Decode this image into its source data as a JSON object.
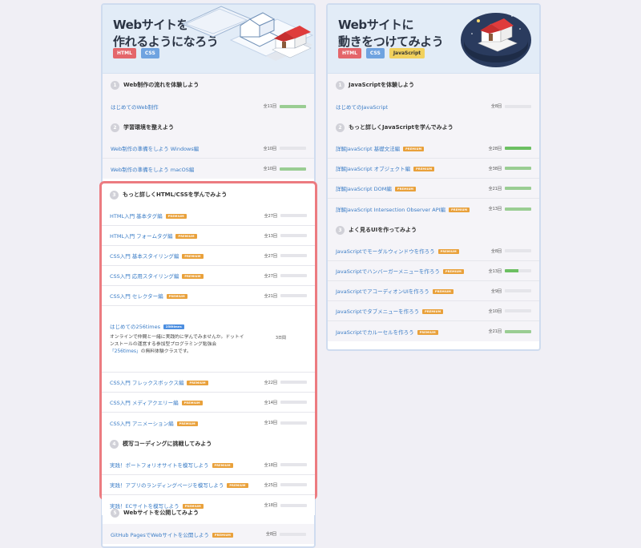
{
  "left": {
    "title": "Webサイトを\n作れるようになろう",
    "tags": [
      "HTML",
      "CSS"
    ],
    "sections": [
      {
        "num": "1",
        "title": "Web制作の流れを体験しよう",
        "items": [
          {
            "title": "はじめてのWeb制作",
            "badge": "",
            "count": "全11回",
            "progress": 1.0
          }
        ]
      },
      {
        "num": "2",
        "title": "学習環境を整えよう",
        "items": [
          {
            "title": "Web制作の準備をしよう Windows編",
            "badge": "",
            "count": "全10回",
            "progress": 0
          },
          {
            "title": "Web制作の準備をしよう macOS編",
            "badge": "",
            "count": "全10回",
            "progress": 1.0
          }
        ]
      }
    ],
    "highlight_sections": [
      {
        "num": "3",
        "title": "もっと詳しくHTML/CSSを学んでみよう",
        "items": [
          {
            "title": "HTML入門 基本タグ編",
            "badge": "PREMIUM",
            "count": "全27回",
            "progress": 0
          },
          {
            "title": "HTML入門 フォームタグ編",
            "badge": "PREMIUM",
            "count": "全13回",
            "progress": 0
          },
          {
            "title": "CSS入門 基本スタイリング編",
            "badge": "PREMIUM",
            "count": "全27回",
            "progress": 0
          },
          {
            "title": "CSS入門 応用スタイリング編",
            "badge": "PREMIUM",
            "count": "全27回",
            "progress": 0
          },
          {
            "title": "CSS入門 セレクター編",
            "badge": "PREMIUM",
            "count": "全21回",
            "progress": 0
          }
        ]
      },
      {
        "extra": {
          "title": "はじめての256times",
          "badge": "256times",
          "desc1": "オンラインで仲間と一緒に実践的に学んでみませんか。ドットインストールの運営する参加型プログラミング勉強会",
          "link": "「256times」",
          "desc2": "の無料体験クラスです。",
          "count": "3日間"
        }
      },
      {
        "items": [
          {
            "title": "CSS入門 フレックスボックス編",
            "badge": "PREMIUM",
            "count": "全22回",
            "progress": 0
          },
          {
            "title": "CSS入門 メディアクエリー編",
            "badge": "PREMIUM",
            "count": "全14回",
            "progress": 0
          },
          {
            "title": "CSS入門 アニメーション編",
            "badge": "PREMIUM",
            "count": "全19回",
            "progress": 0
          }
        ]
      },
      {
        "num": "4",
        "title": "模写コーディングに挑戦してみよう",
        "items": [
          {
            "title": "実践！ポートフォリオサイトを模写しよう",
            "badge": "PREMIUM",
            "count": "全18回",
            "progress": 0
          },
          {
            "title": "実践！アプリのランディングページを模写しよう",
            "badge": "PREMIUM",
            "count": "全25回",
            "progress": 0
          },
          {
            "title": "実践！ECサイトを模写しよう",
            "badge": "PREMIUM",
            "count": "全18回",
            "progress": 0
          }
        ]
      }
    ],
    "lower_sections": [
      {
        "num": "5",
        "title": "Webサイトを公開してみよう",
        "items": [
          {
            "title": "GitHub PagesでWebサイトを公開しよう",
            "badge": "PREMIUM",
            "count": "全8回",
            "progress": 0
          }
        ]
      }
    ]
  },
  "right": {
    "title": "Webサイトに\n動きをつけてみよう",
    "tags": [
      "HTML",
      "CSS",
      "JavaScript"
    ],
    "sections": [
      {
        "num": "1",
        "title": "JavaScriptを体験しよう",
        "items": [
          {
            "title": "はじめてのJavaScript",
            "badge": "",
            "count": "全8回",
            "progress": 0
          }
        ]
      },
      {
        "num": "2",
        "title": "もっと詳しくJavaScriptを学んでみよう",
        "items": [
          {
            "title": "詳解JavaScript 基礎文法編",
            "badge": "PREMIUM",
            "count": "全28回",
            "progress": 1.0
          },
          {
            "title": "詳解JavaScript オブジェクト編",
            "badge": "PREMIUM",
            "count": "全38回",
            "progress": 1.0
          },
          {
            "title": "詳解JavaScript DOM編",
            "badge": "PREMIUM",
            "count": "全21回",
            "progress": 1.0
          },
          {
            "title": "詳解JavaScript Intersection Observer API編",
            "badge": "PREMIUM",
            "count": "全13回",
            "progress": 1.0
          }
        ]
      },
      {
        "num": "3",
        "title": "よく見るUIを作ってみよう",
        "items": [
          {
            "title": "JavaScriptでモーダルウィンドウを作ろう",
            "badge": "PREMIUM",
            "count": "全8回",
            "progress": 0
          },
          {
            "title": "JavaScriptでハンバーガーメニューを作ろう",
            "badge": "PREMIUM",
            "count": "全13回",
            "progress": 0.5
          },
          {
            "title": "JavaScriptでアコーディオンUIを作ろう",
            "badge": "PREMIUM",
            "count": "全9回",
            "progress": 0
          },
          {
            "title": "JavaScriptでタブメニューを作ろう",
            "badge": "PREMIUM",
            "count": "全10回",
            "progress": 0
          },
          {
            "title": "JavaScriptでカルーセルを作ろう",
            "badge": "PREMIUM",
            "count": "全21回",
            "progress": 1.0
          }
        ]
      }
    ]
  }
}
